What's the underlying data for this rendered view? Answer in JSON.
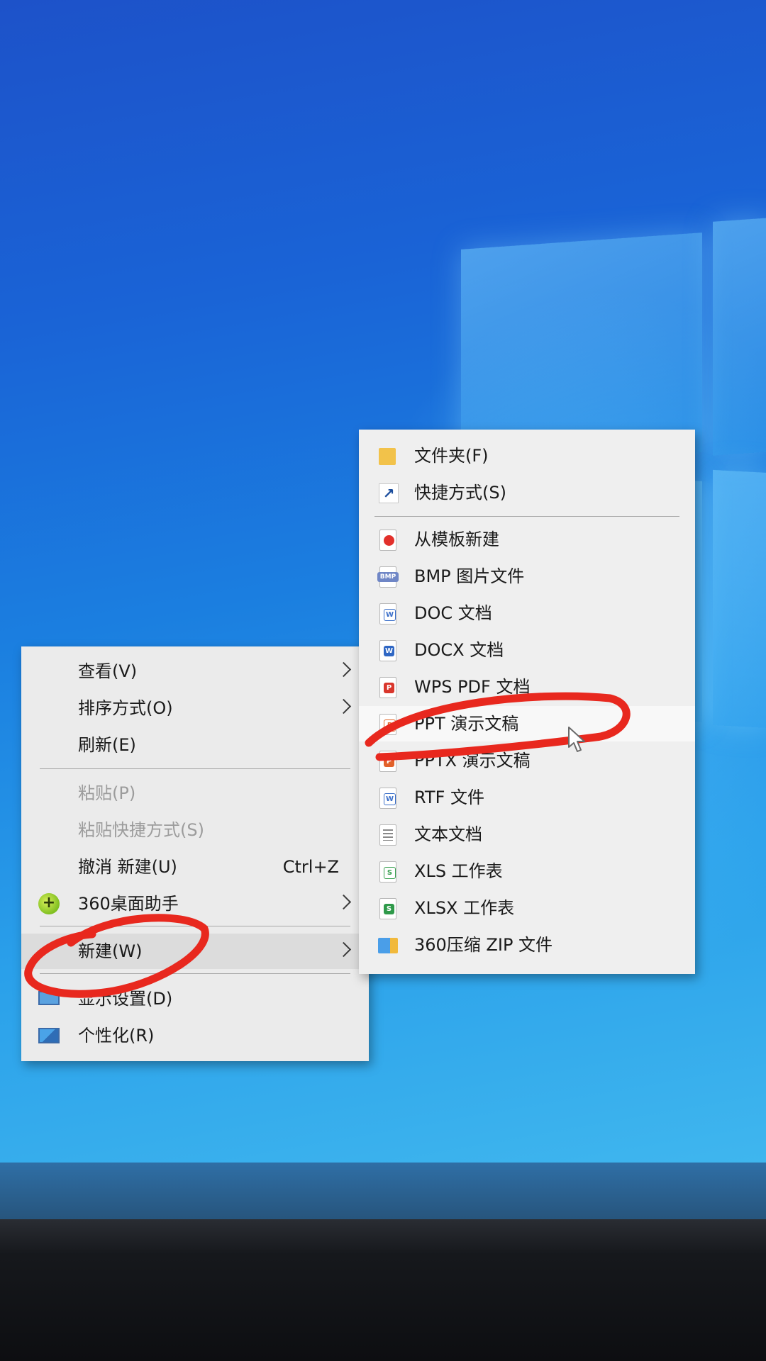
{
  "colors": {
    "accent_annotation": "#e8281e",
    "menu_background": "#ebebeb",
    "disabled_text": "#9c9c9c",
    "desktop_blue": "#1b7fe0"
  },
  "context_menu": {
    "items": [
      {
        "label": "查看(V)",
        "has_submenu": true,
        "icon": ""
      },
      {
        "label": "排序方式(O)",
        "has_submenu": true,
        "icon": ""
      },
      {
        "label": "刷新(E)",
        "has_submenu": false,
        "icon": ""
      },
      {
        "label": "粘贴(P)",
        "disabled": true,
        "icon": ""
      },
      {
        "label": "粘贴快捷方式(S)",
        "disabled": true,
        "icon": ""
      },
      {
        "label": "撤消 新建(U)",
        "shortcut": "Ctrl+Z",
        "icon": ""
      },
      {
        "label": "360桌面助手",
        "has_submenu": true,
        "icon": "360-assistant-icon"
      },
      {
        "label": "新建(W)",
        "has_submenu": true,
        "highlighted": true,
        "icon": ""
      },
      {
        "label": "显示设置(D)",
        "icon": "display-settings-icon"
      },
      {
        "label": "个性化(R)",
        "icon": "personalize-icon"
      }
    ]
  },
  "new_submenu": {
    "items": [
      {
        "label": "文件夹(F)",
        "icon": "folder-icon"
      },
      {
        "label": "快捷方式(S)",
        "icon": "shortcut-icon"
      },
      {
        "label": "从模板新建",
        "icon": "wps-template-icon"
      },
      {
        "label": "BMP 图片文件",
        "icon": "bmp-file-icon",
        "badge": "BMP"
      },
      {
        "label": "DOC 文档",
        "icon": "doc-file-icon",
        "badge": "W"
      },
      {
        "label": "DOCX 文档",
        "icon": "docx-file-icon",
        "badge": "W"
      },
      {
        "label": "WPS PDF 文档",
        "icon": "pdf-file-icon",
        "badge": "P"
      },
      {
        "label": "PPT 演示文稿",
        "icon": "ppt-file-icon",
        "badge": "P",
        "highlighted": true
      },
      {
        "label": "PPTX 演示文稿",
        "icon": "pptx-file-icon",
        "badge": "P"
      },
      {
        "label": "RTF 文件",
        "icon": "rtf-file-icon",
        "badge": "W"
      },
      {
        "label": "文本文档",
        "icon": "text-file-icon"
      },
      {
        "label": "XLS 工作表",
        "icon": "xls-file-icon",
        "badge": "S"
      },
      {
        "label": "XLSX 工作表",
        "icon": "xlsx-file-icon",
        "badge": "S"
      },
      {
        "label": "360压缩 ZIP 文件",
        "icon": "zip-file-icon"
      }
    ]
  },
  "icon_glyphs": {
    "shortcut_arrow": "↗",
    "plus": "+"
  }
}
